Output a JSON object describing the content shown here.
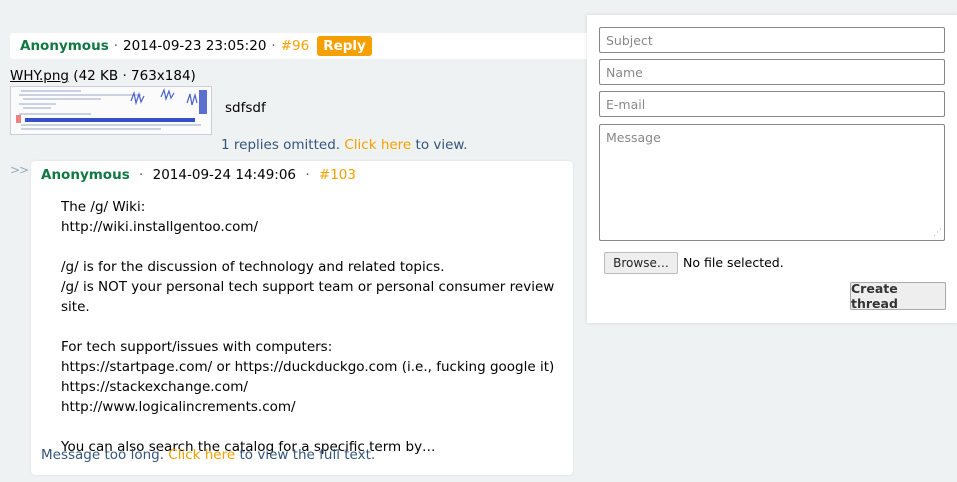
{
  "op": {
    "name": "Anonymous",
    "sep": "·",
    "date": "2014-09-23 23:05:20",
    "post_no": "#96",
    "reply_label": "Reply",
    "file_name": "WHY.png",
    "file_meta": "(42 KB · 763x184)",
    "text": "sdfsdf",
    "omitted_prefix": "1 replies omitted.",
    "omitted_link": "Click here",
    "omitted_suffix": "to view."
  },
  "reply": {
    "arrows": ">>",
    "name": "Anonymous",
    "sep": "·",
    "date": "2014-09-24 14:49:06",
    "post_no": "#103",
    "lines": [
      "The /g/ Wiki:",
      "http://wiki.installgentoo.com/",
      "",
      "/g/ is for the discussion of technology and related topics.",
      "/g/ is NOT your personal tech support team or personal consumer review site.",
      "",
      "For tech support/issues with computers:",
      "https://startpage.com/ or https://duckduckgo.com (i.e., fucking google it)",
      "https://stackexchange.com/",
      "http://www.logicalincrements.com/",
      "",
      "You can also search the catalog for a specific term by…"
    ],
    "too_long_prefix": "Message too long.",
    "too_long_link": "Click here",
    "too_long_suffix": "to view the full text."
  },
  "form": {
    "subject_placeholder": "Subject",
    "name_placeholder": "Name",
    "email_placeholder": "E-mail",
    "message_placeholder": "Message",
    "browse_label": "Browse…",
    "no_file": "No file selected.",
    "submit_label": "Create thread"
  },
  "colors": {
    "name": "#117743",
    "accent": "#f5a000",
    "info": "#34557a"
  }
}
